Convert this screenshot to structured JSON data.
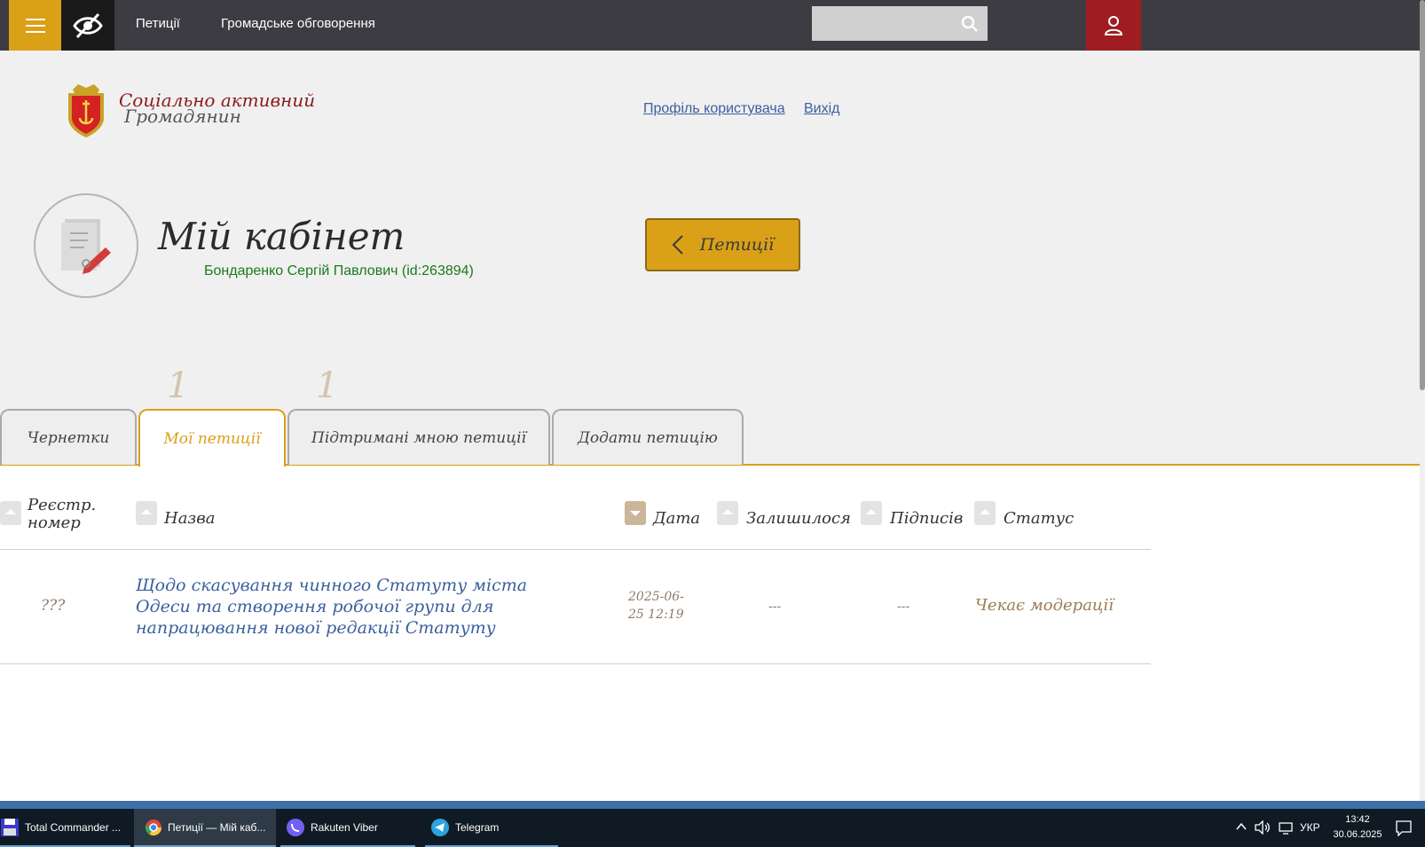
{
  "nav": {
    "items": [
      "Петиції",
      "Громадське обговорення"
    ],
    "search_placeholder": ""
  },
  "header": {
    "logo_line1": "Соціально активний",
    "logo_line2": "Громадянин",
    "profile_link": "Профіль користувача",
    "exit_link": "Вихід"
  },
  "cabinet": {
    "title": "Мій кабінет",
    "user": "Бондаренко Сергій Павлович (id:263894)",
    "petitions_button": "Петиції"
  },
  "tabs": [
    {
      "label": "Чернетки",
      "count": "",
      "active": false
    },
    {
      "label": "Мої петиції",
      "count": "1",
      "active": true
    },
    {
      "label": "Підтримані мною петиції",
      "count": "1",
      "active": false
    },
    {
      "label": "Додати петицію",
      "count": "",
      "active": false
    }
  ],
  "table": {
    "columns": [
      "Реєстр. номер",
      "Назва",
      "Дата",
      "Залишилося",
      "Підписів",
      "Статус"
    ],
    "rows": [
      {
        "reg_number": "???",
        "title": "Щодо скасування чинного Статуту міста Одеси та створення робочої групи для напрацювання нової редакції Статуту",
        "date": "2025-06-25 12:19",
        "remaining": "---",
        "signatures": "---",
        "status": "Чекає модерації"
      }
    ]
  },
  "taskbar": {
    "apps": [
      "Total Commander ...",
      "Петиції — Мій каб...",
      "Rakuten Viber",
      "Telegram"
    ],
    "lang": "УКР",
    "time": "13:42",
    "date": "30.06.2025"
  },
  "colors": {
    "accent": "#daa017",
    "topbar": "#3d3c42",
    "user_button": "#9f1d20",
    "link": "#3b5f9e",
    "user_name": "#1a7a1a"
  }
}
